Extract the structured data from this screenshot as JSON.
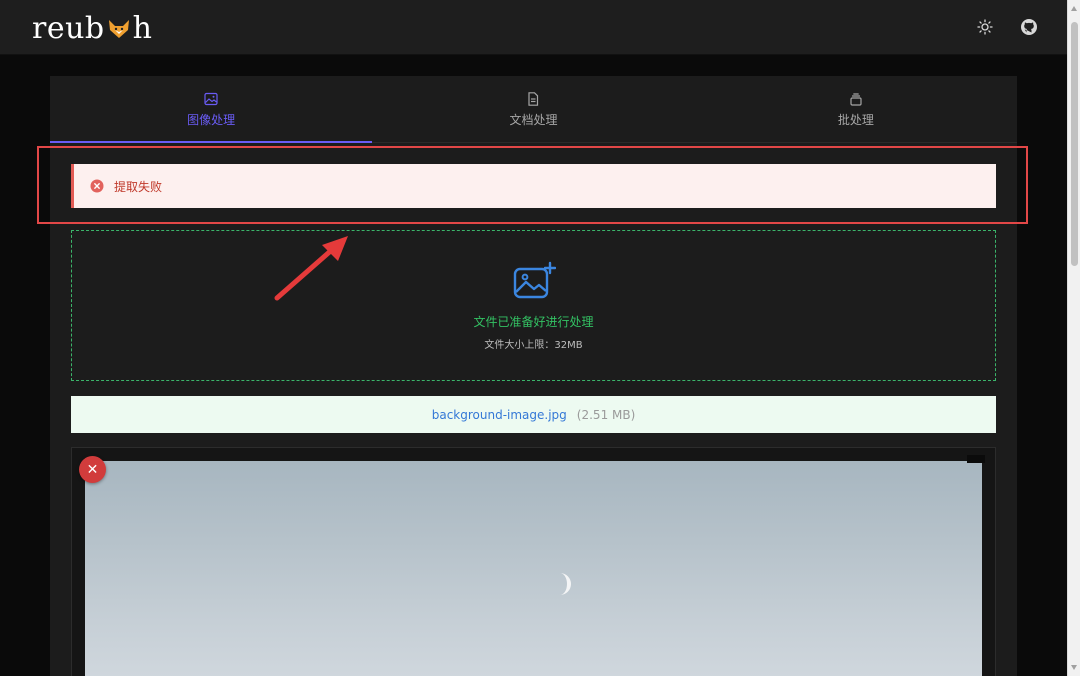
{
  "app": {
    "logo_text_left": "reub",
    "logo_text_right": "h"
  },
  "header": {
    "theme_toggle_icon": "sun-icon",
    "github_icon": "github-icon"
  },
  "tabs": [
    {
      "label": "图像处理",
      "icon": "image-icon",
      "active": true
    },
    {
      "label": "文档处理",
      "icon": "document-icon",
      "active": false
    },
    {
      "label": "批处理",
      "icon": "layers-icon",
      "active": false
    }
  ],
  "alert": {
    "message": "提取失败",
    "icon": "error-circle-icon"
  },
  "dropzone": {
    "status": "文件已准备好进行处理",
    "limit": "文件大小上限：32MB",
    "icon": "image-add-icon"
  },
  "file": {
    "name": "background-image.jpg",
    "size": "(2.51 MB)"
  },
  "preview": {
    "close_label": "✕"
  },
  "colors": {
    "accent": "#6a5cf5",
    "error": "#e25b55",
    "success": "#33c163",
    "link": "#3478d6",
    "annotation": "#e24747"
  }
}
